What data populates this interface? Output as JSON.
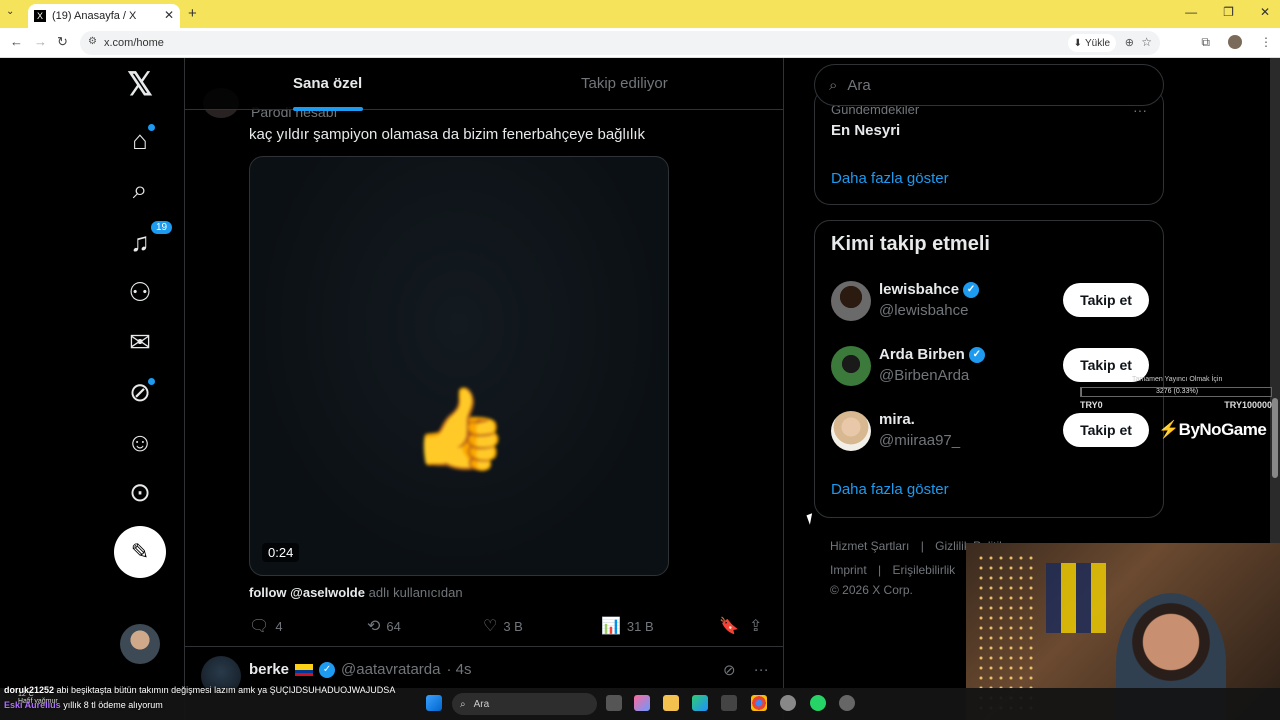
{
  "browser": {
    "tab_title": "(19) Anasayfa / X",
    "tab_favicon": "X",
    "url": "x.com/home",
    "yukle_label": "Yükle",
    "new_tab_symbol": "+",
    "close_symbol": "✕"
  },
  "nav": {
    "notifications_badge": "19",
    "icons": [
      "x-logo-icon",
      "home-icon",
      "explore-icon",
      "notifications-icon",
      "follow-icon",
      "messages-icon",
      "grok-icon",
      "profile-icon",
      "more-icon"
    ]
  },
  "feed": {
    "tabs": {
      "for_you": "Sana özel",
      "following": "Takip ediliyor"
    },
    "tweet1": {
      "account_label": "Parodi hesabı",
      "text": "kaç yıldır şampiyon olamasa da bizim fenerbahçeye bağlılık",
      "video_duration": "0:24",
      "attribution_user": "follow @aselwolde",
      "attribution_suffix": "adlı kullanıcıdan",
      "replies": "4",
      "reposts": "64",
      "likes": "3 B",
      "views": "31 B"
    },
    "tweet2": {
      "name": "berke",
      "handle": "@aatavratarda",
      "time": "· 4s"
    }
  },
  "sidebar": {
    "search_placeholder": "Ara",
    "trend": {
      "subtitle": "Gündemdekiler",
      "name": "En Nesyri",
      "more": "···"
    },
    "show_more_1": "Daha fazla göster",
    "who_to_follow_title": "Kimi takip etmeli",
    "users": [
      {
        "name": "lewisbahce",
        "handle": "@lewisbahce",
        "verified": true,
        "button": "Takip et"
      },
      {
        "name": "Arda Birben",
        "handle": "@BirbenArda",
        "verified": true,
        "button": "Takip et"
      },
      {
        "name": "mira.",
        "handle": "@miiraa97_",
        "verified": false,
        "button": "Takip et"
      }
    ],
    "show_more_2": "Daha fazla göster",
    "footer": {
      "line1": [
        "Hizmet Şartları",
        "|",
        "Gizlilik Politikası"
      ],
      "line2": [
        "Imprint",
        "|",
        "Erişilebilirlik",
        "|"
      ],
      "copyright": "© 2026 X Corp."
    }
  },
  "stream_overlay": {
    "goal_label": "Tamamen Yayıncı Olmak İçin",
    "goal_progress": "3276 (0.33%)",
    "progress_fraction": 0.0033,
    "left_amount": "TRY0",
    "right_amount": "TRY100000",
    "brand": "ByNoGame"
  },
  "chat": {
    "line1_user": "doruk21252",
    "line1_text": "abi beşiktaşta bütün takımın değişmesi lazım amk ya ŞUÇIJDSUHADUOJWAJUDSA",
    "line2_user": "Eski Aurelius",
    "line2_text": "yıllık 8 tl ödeme alıyorum"
  },
  "taskbar": {
    "search_label": "Ara",
    "weather_temp": "12°C",
    "weather_desc": "Hafif yağmur"
  },
  "colors": {
    "accent": "#1d9bf0",
    "background": "#000000",
    "title_bar": "#f6e35c"
  }
}
